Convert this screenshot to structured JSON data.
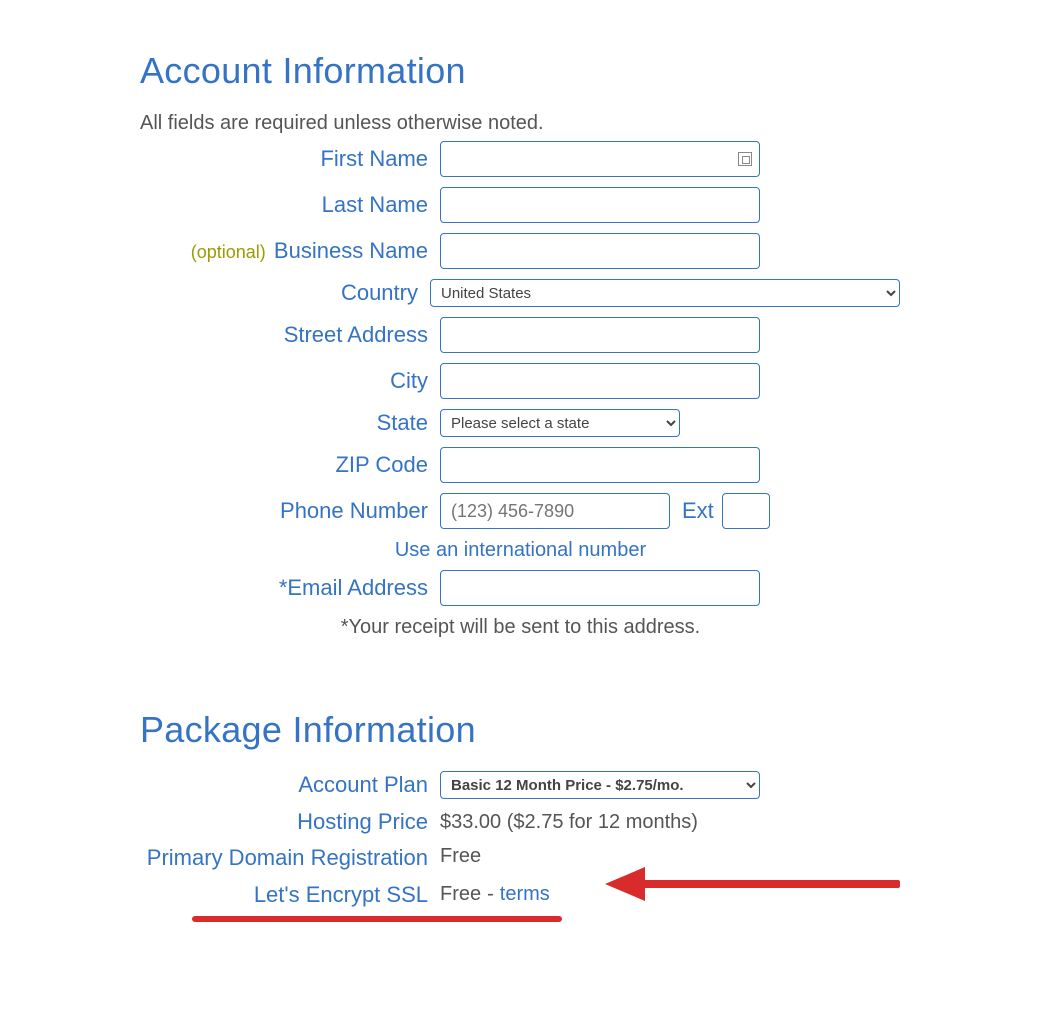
{
  "account": {
    "title": "Account Information",
    "requiredNote": "All fields are required unless otherwise noted.",
    "fields": {
      "firstName": {
        "label": "First Name",
        "value": ""
      },
      "lastName": {
        "label": "Last Name",
        "value": ""
      },
      "businessOptional": "(optional)",
      "businessName": {
        "label": "Business Name",
        "value": ""
      },
      "country": {
        "label": "Country",
        "selected": "United States"
      },
      "street": {
        "label": "Street Address",
        "value": ""
      },
      "city": {
        "label": "City",
        "value": ""
      },
      "state": {
        "label": "State",
        "selected": "Please select a state"
      },
      "zip": {
        "label": "ZIP Code",
        "value": ""
      },
      "phone": {
        "label": "Phone Number",
        "placeholder": "(123) 456-7890",
        "value": ""
      },
      "extLabel": "Ext",
      "extValue": "",
      "intlLink": "Use an international number",
      "email": {
        "label": "*Email Address",
        "value": ""
      },
      "emailNote": "*Your receipt will be sent to this address."
    }
  },
  "package": {
    "title": "Package Information",
    "plan": {
      "label": "Account Plan",
      "selected": "Basic 12 Month Price - $2.75/mo."
    },
    "hosting": {
      "label": "Hosting Price",
      "value": "$33.00  ($2.75 for 12 months)"
    },
    "domain": {
      "label": "Primary Domain Registration",
      "value": "Free"
    },
    "ssl": {
      "label": "Let's Encrypt SSL",
      "value": "Free",
      "sep": " - ",
      "terms": "terms"
    }
  }
}
